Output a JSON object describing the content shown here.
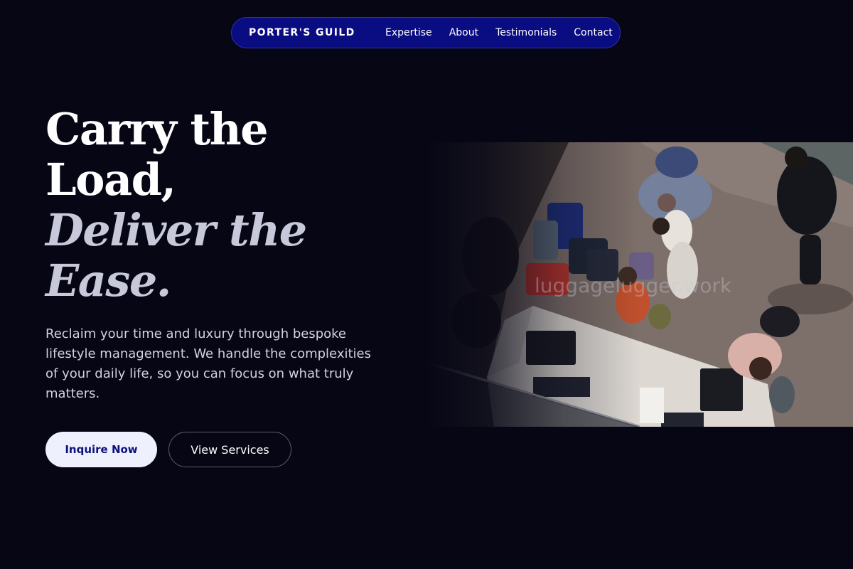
{
  "nav": {
    "brand": "PORTER'S GUILD",
    "links": [
      {
        "label": "Expertise"
      },
      {
        "label": "About"
      },
      {
        "label": "Testimonials"
      },
      {
        "label": "Contact"
      }
    ]
  },
  "hero": {
    "headline_line1": "Carry the",
    "headline_line2": "Load,",
    "headline_line3": "Deliver the",
    "headline_line4": "Ease.",
    "lead": "Reclaim your time and luxury through bespoke lifestyle management. We handle the complexities of your daily life, so you can focus on what truly matters.",
    "primary_cta": "Inquire Now",
    "secondary_cta": "View Services",
    "image_watermark": "luggagelugger.work"
  },
  "colors": {
    "background": "#060615",
    "nav_background": "#0a0c82",
    "primary_button_bg": "#eef1fd",
    "primary_button_text": "#0e107e",
    "accent_text": "#c7c8d9"
  }
}
